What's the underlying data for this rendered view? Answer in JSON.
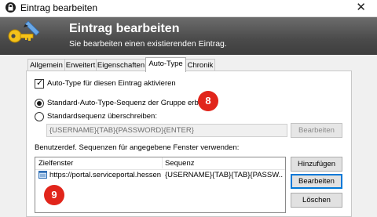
{
  "window": {
    "title": "Eintrag bearbeiten",
    "close_glyph": "✕"
  },
  "banner": {
    "title": "Eintrag bearbeiten",
    "subtitle": "Sie bearbeiten einen existierenden Eintrag.",
    "icon": "key-pen-icon"
  },
  "tabs": [
    {
      "label": "Allgemein",
      "active": false
    },
    {
      "label": "Erweitert",
      "active": false
    },
    {
      "label": "Eigenschaften",
      "active": false
    },
    {
      "label": "Auto-Type",
      "active": true
    },
    {
      "label": "Chronik",
      "active": false
    }
  ],
  "autotype": {
    "enable_label": "Auto-Type für diesen Eintrag aktivieren",
    "enable_checked": true,
    "standard_group_label": "Standard-Auto-Type-Sequenz der Gruppe erben",
    "standard_group_selected": true,
    "override_label": "Standardsequenz überschreiben:",
    "override_selected": false,
    "override_value": "{USERNAME}{TAB}{PASSWORD}{ENTER}",
    "edit_button": "Bearbeiten",
    "window_sequences_label": "Benutzerdef. Sequenzen für angegebene Fenster verwenden:",
    "columns": [
      "Zielfenster",
      "Sequenz"
    ],
    "rows": [
      {
        "target": "https://portal.serviceportal.hessen....",
        "sequence": "{USERNAME}{TAB}{TAB}{PASSW..."
      }
    ],
    "buttons": {
      "add": "Hinzufügen",
      "edit": "Bearbeiten",
      "delete": "Löschen"
    }
  },
  "callouts": {
    "first": "8",
    "second": "9"
  },
  "colors": {
    "callout": "#e1251b",
    "focus": "#0078d7"
  }
}
